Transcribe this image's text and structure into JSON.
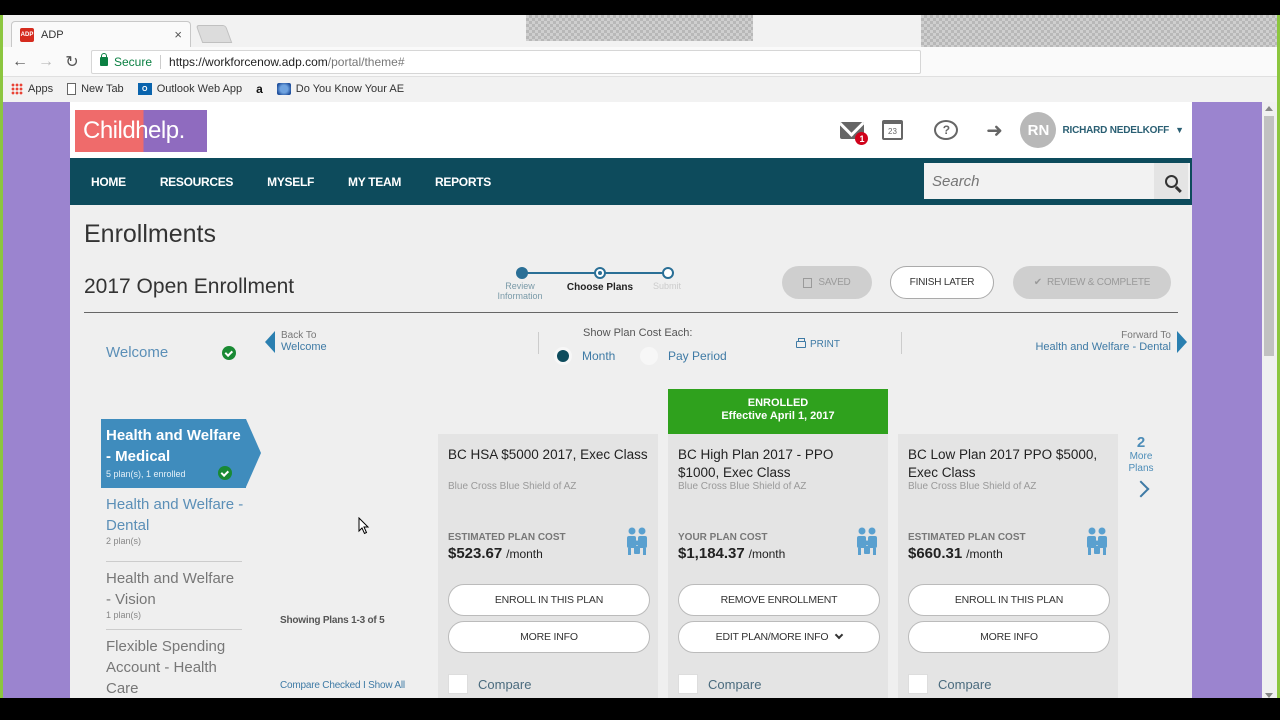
{
  "browser": {
    "tab_title": "ADP",
    "favicon_label": "ADP",
    "secure_label": "Secure",
    "url_host": "https://workforcenow.adp.com",
    "url_path": "/portal/theme#",
    "bookmarks": [
      {
        "label": "Apps",
        "icon": "apps-grid-icon"
      },
      {
        "label": "New Tab",
        "icon": "page-icon"
      },
      {
        "label": "Outlook Web App",
        "icon": "outlook-icon"
      },
      {
        "label": "",
        "icon": "amazon-icon",
        "glyph": "a"
      },
      {
        "label": "Do You Know Your AE",
        "icon": "globe-icon"
      }
    ]
  },
  "header": {
    "logo_text": "Childhelp.",
    "mail_badge": "1",
    "calendar_day": "23",
    "help_glyph": "?",
    "logout_glyph": "➜",
    "avatar_initials": "RN",
    "user_name": "RICHARD NEDELKOFF"
  },
  "nav": {
    "items": [
      "HOME",
      "RESOURCES",
      "MYSELF",
      "MY TEAM",
      "REPORTS"
    ],
    "search_placeholder": "Search"
  },
  "page": {
    "title": "Enrollments",
    "subtitle": "2017 Open Enrollment",
    "steps": [
      {
        "label": "Review Information",
        "state": "done"
      },
      {
        "label": "Choose Plans",
        "state": "current"
      },
      {
        "label": "Submit",
        "state": "future"
      }
    ],
    "buttons": {
      "saved": "SAVED",
      "finish_later": "FINISH LATER",
      "review_complete": "REVIEW & COMPLETE"
    }
  },
  "subnav": {
    "back_prefix": "Back To",
    "back_target": "Welcome",
    "cost_label": "Show Plan Cost Each:",
    "cost_options": [
      "Month",
      "Pay Period"
    ],
    "cost_selected": "Month",
    "print": "PRINT",
    "forward_prefix": "Forward To",
    "forward_target": "Health and Welfare - Dental"
  },
  "sidebar": {
    "welcome": "Welcome",
    "items": [
      {
        "title": "Health and Welfare - Medical",
        "sub": "5 plan(s), 1 enrolled",
        "active": true,
        "complete": true
      },
      {
        "title": "Health and Welfare - Dental",
        "sub": "2 plan(s)"
      },
      {
        "title": "Health and Welfare - Vision",
        "sub": "1 plan(s)"
      },
      {
        "title": "Flexible Spending Account - Health Care",
        "sub": ""
      }
    ]
  },
  "plans": {
    "showing": "Showing Plans 1-3 of 5",
    "compare_checked": "Compare Checked",
    "compare_sep": "I",
    "show_all": "Show All",
    "more_count": "2",
    "more_label": "More Plans",
    "cards": [
      {
        "name": "BC HSA $5000 2017, Exec Class",
        "carrier": "Blue Cross Blue Shield of AZ",
        "cost_label": "ESTIMATED PLAN COST",
        "cost": "$523.67",
        "per": "/month",
        "btn1": "ENROLL IN THIS PLAN",
        "btn2": "MORE INFO",
        "compare": "Compare",
        "enrolled": false
      },
      {
        "name": "BC High Plan 2017 - PPO $1000, Exec Class",
        "carrier": "Blue Cross Blue Shield of AZ",
        "cost_label": "YOUR PLAN COST",
        "cost": "$1,184.37",
        "per": "/month",
        "btn1": "REMOVE ENROLLMENT",
        "btn2": "EDIT PLAN/MORE INFO",
        "compare": "Compare",
        "enrolled": true,
        "banner_title": "ENROLLED",
        "banner_sub": "Effective April 1, 2017"
      },
      {
        "name": "BC Low Plan 2017 PPO $5000, Exec Class",
        "carrier": "Blue Cross Blue Shield of AZ",
        "cost_label": "ESTIMATED PLAN COST",
        "cost": "$660.31",
        "per": "/month",
        "btn1": "ENROLL IN THIS PLAN",
        "btn2": "MORE INFO",
        "compare": "Compare",
        "enrolled": false
      }
    ]
  },
  "colors": {
    "nav_bg": "#0d4b5c",
    "accent_blue": "#3f8cbd",
    "enrolled_green": "#2fa11d",
    "page_purple": "#9b84cf"
  }
}
